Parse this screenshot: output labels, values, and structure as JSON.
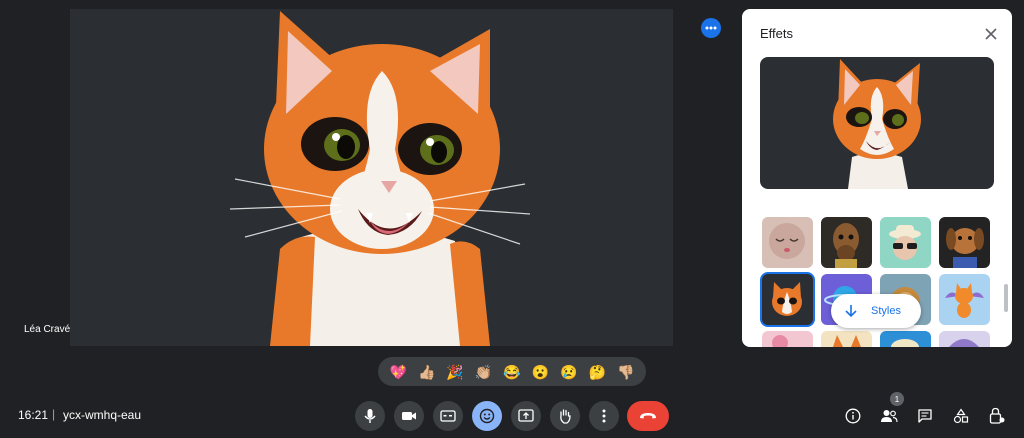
{
  "participant": {
    "name": "Léa Cravé"
  },
  "effects_panel": {
    "title": "Effets",
    "styles_button_label": "Styles",
    "effect_tiles": [
      {
        "name": "closed-eyes-face-effect"
      },
      {
        "name": "horse-effect"
      },
      {
        "name": "sunglasses-hat-effect"
      },
      {
        "name": "dog-effect"
      },
      {
        "name": "orange-cat-effect",
        "selected": true
      },
      {
        "name": "planet-effect"
      },
      {
        "name": "lion-effect"
      },
      {
        "name": "winged-cat-effect"
      },
      {
        "name": "pink-flower-effect"
      },
      {
        "name": "cat-ears-effect"
      },
      {
        "name": "blue-sky-effect"
      },
      {
        "name": "purple-hat-effect"
      }
    ]
  },
  "reactions": [
    "💖",
    "👍🏼",
    "🎉",
    "👏🏼",
    "😂",
    "😮",
    "😢",
    "🤔",
    "👎🏼"
  ],
  "meeting": {
    "time": "16:21",
    "separator": "|",
    "code": "ycx-wmhq-eau"
  },
  "people_count": "1",
  "colors": {
    "accent": "#1a73e8",
    "hangup": "#ea4335",
    "active_control": "#8ab4f8",
    "background": "#202124"
  }
}
